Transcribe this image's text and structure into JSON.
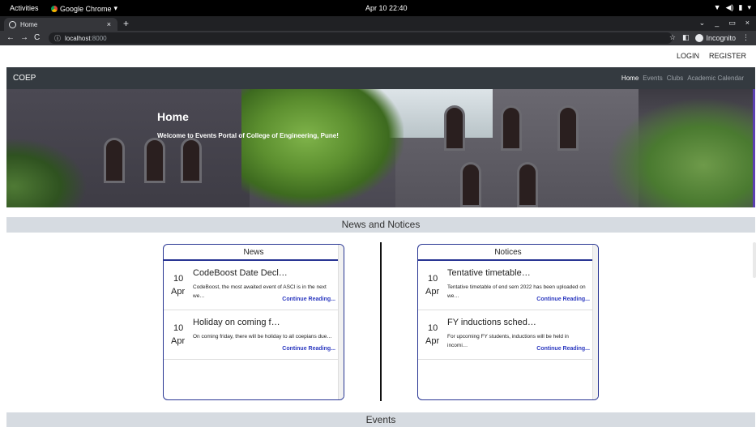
{
  "os": {
    "activities": "Activities",
    "app_name": "Google Chrome",
    "clock": "Apr 10 22:40",
    "tray": [
      "▼",
      "◀)",
      "▮",
      "▾"
    ]
  },
  "browser": {
    "tab_title": "Home",
    "tab_close": "×",
    "new_tab": "+",
    "win_controls": [
      "⌄",
      "_",
      "▭",
      "×"
    ],
    "url_host": "localhost",
    "url_port": ":8000",
    "incognito": "Incognito"
  },
  "auth": {
    "login": "LOGIN",
    "register": "REGISTER"
  },
  "navbar": {
    "brand": "COEP",
    "links": [
      "Home",
      "Events",
      "Clubs",
      "Academic Calendar"
    ],
    "active_index": 0
  },
  "hero": {
    "title": "Home",
    "subtitle": "Welcome to Events Portal of College of Engineering, Pune!"
  },
  "sections": {
    "news_and_notices": "News and Notices",
    "events": "Events"
  },
  "news": {
    "heading": "News",
    "items": [
      {
        "day": "10",
        "month": "Apr",
        "title": "CodeBoost Date Decl…",
        "desc": "CodeBoost, the most awaited event of ASCI is in the next we…",
        "link": "Continue Reading..."
      },
      {
        "day": "10",
        "month": "Apr",
        "title": "Holiday on coming f…",
        "desc": "On coming friday, there will be holiday to all coepians due…",
        "link": "Continue Reading..."
      }
    ]
  },
  "notices": {
    "heading": "Notices",
    "items": [
      {
        "day": "10",
        "month": "Apr",
        "title": "Tentative timetable…",
        "desc": "Tentative timetable of end sem 2022 has been uploaded on we…",
        "link": "Continue Reading..."
      },
      {
        "day": "10",
        "month": "Apr",
        "title": "FY inductions sched…",
        "desc": "For upcoming FY students, inductions will be held in incomi…",
        "link": "Continue Reading..."
      }
    ]
  },
  "colors": {
    "navbar_bg": "#343a40",
    "section_bg": "#d6dbe1",
    "panel_border": "#283593",
    "link": "#2c39c0"
  }
}
